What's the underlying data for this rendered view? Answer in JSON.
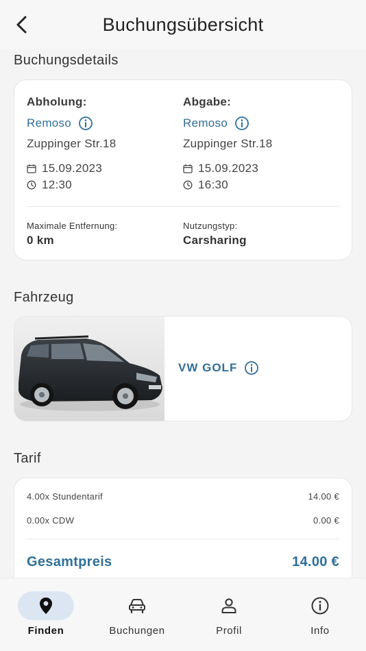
{
  "header": {
    "title": "Buchungsübersicht"
  },
  "booking": {
    "section_title": "Buchungsdetails",
    "pickup": {
      "label": "Abholung:",
      "location": "Remoso",
      "address": "Zuppinger Str.18",
      "date": "15.09.2023",
      "time": "12:30"
    },
    "dropoff": {
      "label": "Abgabe:",
      "location": "Remoso",
      "address": "Zuppinger Str.18",
      "date": "15.09.2023",
      "time": "16:30"
    },
    "max_distance": {
      "label": "Maximale Entfernung:",
      "value": "0 km"
    },
    "usage_type": {
      "label": "Nutzungstyp:",
      "value": "Carsharing"
    }
  },
  "vehicle": {
    "section_title": "Fahrzeug",
    "name": "VW GOLF"
  },
  "tariff": {
    "section_title": "Tarif",
    "lines": [
      {
        "label": "4.00x Stundentarif",
        "amount": "14.00 €"
      },
      {
        "label": "0.00x CDW",
        "amount": "0.00 €"
      }
    ],
    "total_label": "Gesamtpreis",
    "total_amount": "14.00 €"
  },
  "nav": {
    "items": [
      {
        "label": "Finden",
        "icon": "location-pin-icon",
        "active": true
      },
      {
        "label": "Buchungen",
        "icon": "car-icon",
        "active": false
      },
      {
        "label": "Profil",
        "icon": "person-icon",
        "active": false
      },
      {
        "label": "Info",
        "icon": "info-icon",
        "active": false
      }
    ]
  },
  "colors": {
    "accent": "#2f6f9a",
    "nav_active_bg": "#dce6f2",
    "background": "#f4f4f4",
    "card": "#ffffff"
  }
}
